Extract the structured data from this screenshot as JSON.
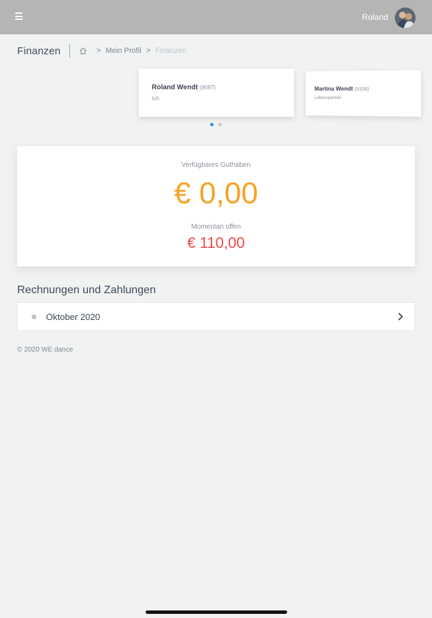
{
  "topbar": {
    "menu_icon": "hamburger-menu-icon",
    "user_name": "Roland"
  },
  "header": {
    "title": "Finanzen",
    "breadcrumb": {
      "home_icon": "home-icon",
      "items": [
        "Mein Profil",
        "Finanzen"
      ]
    }
  },
  "members": [
    {
      "name": "Roland Wendt",
      "id": "(9097)",
      "role": "Ich"
    },
    {
      "name": "Martina Wendt",
      "id": "(9108)",
      "role": "Lebenspartner"
    }
  ],
  "carousel": {
    "pages": 2,
    "active": 0
  },
  "balance": {
    "available_label": "Verfügbares Guthaben",
    "available_amount": "€ 0,00",
    "open_label": "Momentan offen",
    "open_amount": "€ 110,00"
  },
  "invoices": {
    "title": "Rechnungen und Zahlungen",
    "items": [
      {
        "label": "Oktober 2020",
        "icon": "chevron-right-icon"
      }
    ]
  },
  "footer": {
    "text": "© 2020 WE dance"
  },
  "colors": {
    "topbar": "#b5b5b5",
    "accent_orange": "#f5a323",
    "accent_red": "#ea4a4a",
    "accent_blue": "#2d8cf0"
  }
}
